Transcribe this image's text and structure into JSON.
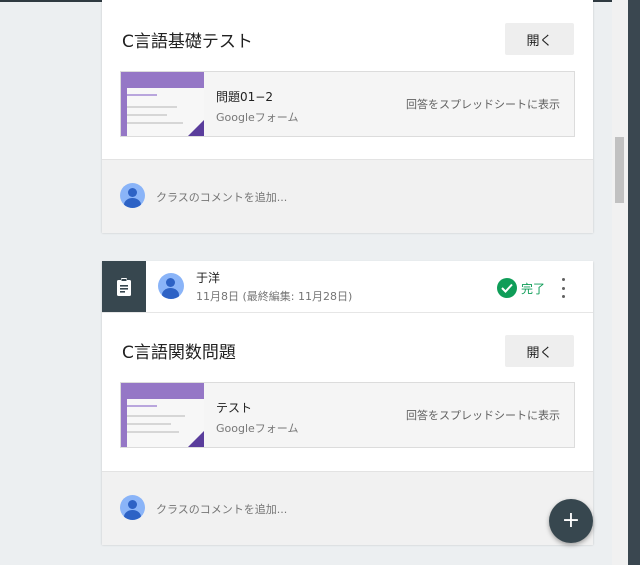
{
  "card1": {
    "title": "C言語基礎テスト",
    "open_label": "開く",
    "attachment": {
      "title": "問題01−2",
      "subtitle": "Googleフォーム",
      "action": "回答をスプレッドシートに表示"
    },
    "comment_placeholder": "クラスのコメントを追加..."
  },
  "card2": {
    "author": "于洋",
    "date": "11月8日 (最終編集: 11月28日)",
    "status": "完了",
    "title": "C言語関数問題",
    "open_label": "開く",
    "attachment": {
      "title": "テスト",
      "subtitle": "Googleフォーム",
      "action": "回答をスプレッドシートに表示"
    },
    "comment_placeholder": "クラスのコメントを追加..."
  },
  "fab_label": "+",
  "colors": {
    "accent_dark": "#37474f",
    "done_green": "#0f9d58",
    "form_purple": "#9577c6",
    "avatar_blue": "#8ab4f8"
  },
  "icons": [
    "assignment-icon",
    "avatar-icon",
    "check-circle-icon",
    "more-vert-icon",
    "add-icon"
  ]
}
